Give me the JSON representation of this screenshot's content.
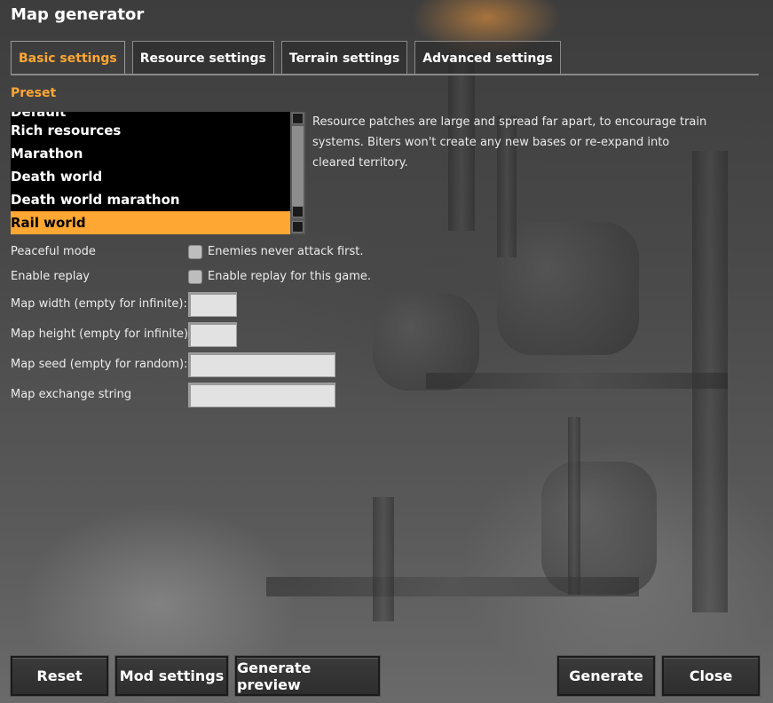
{
  "window": {
    "title": "Map generator"
  },
  "tabs": [
    {
      "label": "Basic settings",
      "active": true
    },
    {
      "label": "Resource settings",
      "active": false
    },
    {
      "label": "Terrain settings",
      "active": false
    },
    {
      "label": "Advanced settings",
      "active": false
    }
  ],
  "preset": {
    "label": "Preset",
    "items": [
      {
        "label": "Default",
        "partial": true
      },
      {
        "label": "Rich resources"
      },
      {
        "label": "Marathon"
      },
      {
        "label": "Death world"
      },
      {
        "label": "Death world marathon"
      },
      {
        "label": "Rail world",
        "selected": true
      }
    ],
    "description": "Resource patches are large and spread far apart, to encourage train systems. Biters won't create any new bases or re-expand into cleared territory."
  },
  "options": {
    "peaceful": {
      "label": "Peaceful mode",
      "checkbox_label": "Enemies never attack first.",
      "checked": false
    },
    "replay": {
      "label": "Enable replay",
      "checkbox_label": "Enable replay for this game.",
      "checked": false
    }
  },
  "fields": {
    "map_width": {
      "label": "Map width (empty for infinite):",
      "value": ""
    },
    "map_height": {
      "label": "Map height (empty for infinite):",
      "value": ""
    },
    "map_seed": {
      "label": "Map seed (empty for random):",
      "value": ""
    },
    "map_exchange": {
      "label": "Map exchange string",
      "value": ""
    }
  },
  "buttons": {
    "reset": "Reset",
    "mod_settings": "Mod settings",
    "generate_preview": "Generate preview",
    "generate": "Generate",
    "close": "Close"
  },
  "colors": {
    "accent": "#ffa733",
    "list_bg": "#000000",
    "field_bg": "#e2e2e2"
  }
}
